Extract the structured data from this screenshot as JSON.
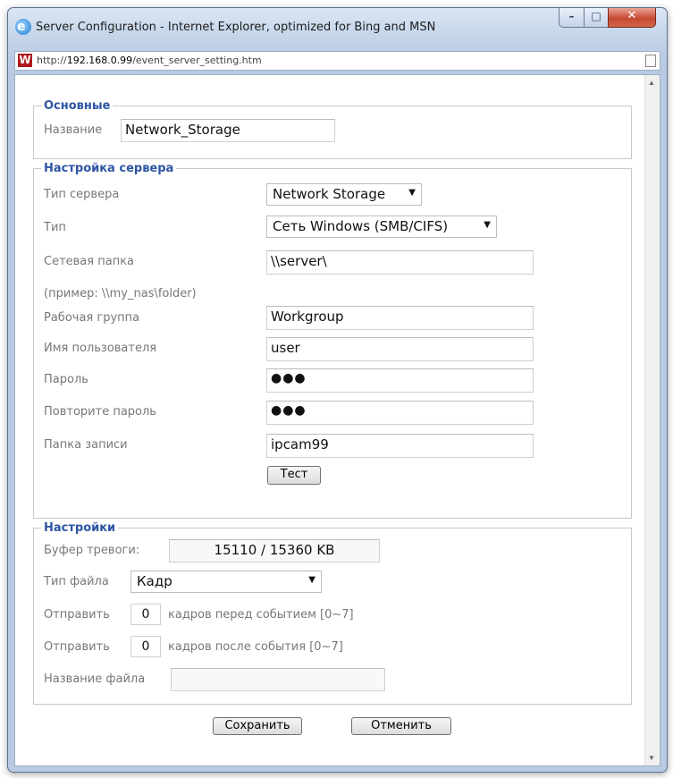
{
  "window": {
    "title": "Server Configuration - Internet Explorer, optimized for Bing and MSN",
    "url_prefix": "http://",
    "url_host": "192.168.0.99",
    "url_path": "/event_server_setting.htm",
    "icons": [
      "ie-icon",
      "minimize-icon",
      "maximize-icon",
      "close-icon",
      "site-logo-icon",
      "page-icon"
    ]
  },
  "basic": {
    "legend": "Основные",
    "name_label": "Название",
    "name_value": "Network_Storage"
  },
  "server": {
    "legend": "Настройка сервера",
    "server_type_label": "Тип сервера",
    "server_type_value": "Network Storage",
    "type_label": "Тип",
    "type_value": "Сеть Windows (SMB/CIFS)",
    "folder_label": "Сетевая папка",
    "folder_value": "\\\\server\\",
    "example": "(пример: \\\\my_nas\\folder)",
    "workgroup_label": "Рабочая группа",
    "workgroup_value": "Workgroup",
    "user_label": "Имя пользователя",
    "user_value": "user",
    "password_label": "Пароль",
    "password_value": "●●●",
    "password_repeat_label": "Повторите пароль",
    "password_repeat_value": "●●●",
    "record_folder_label": "Папка записи",
    "record_folder_value": "ipcam99",
    "test_button": "Тест"
  },
  "settings": {
    "legend": "Настройки",
    "buffer_label": "Буфер тревоги:",
    "buffer_value": "15110 / 15360 KB",
    "file_type_label": "Тип файла",
    "file_type_value": "Кадр",
    "send_label": "Отправить",
    "pre_value": "0",
    "pre_text": "кадров перед событием [0~7]",
    "post_value": "0",
    "post_text": "кадров после события [0~7]",
    "filename_label": "Название файла",
    "filename_value": ""
  },
  "actions": {
    "save": "Сохранить",
    "cancel": "Отменить"
  }
}
